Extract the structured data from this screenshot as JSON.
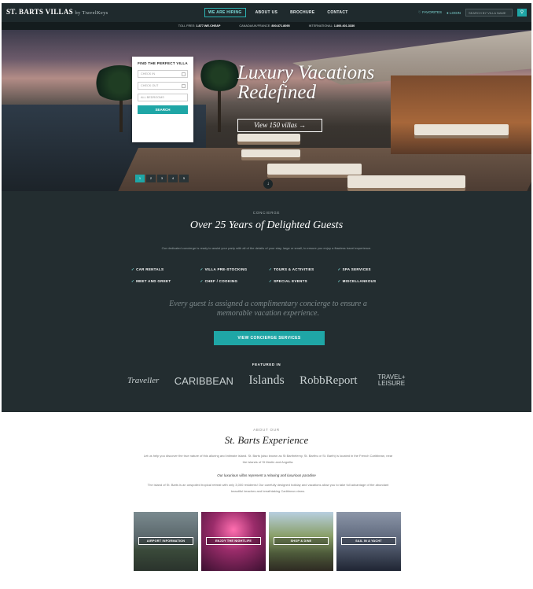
{
  "header": {
    "logo": "ST. BARTS VILLAS",
    "logo_sub": "by TravelKeys",
    "nav": [
      "WE ARE HIRING",
      "ABOUT US",
      "BROCHURE",
      "CONTACT"
    ],
    "links": [
      "FAVORITES",
      "LOGIN"
    ],
    "search_placeholder": "SEARCH BY VILLA NAME",
    "search_icon": "search-icon",
    "phones": [
      {
        "label": "TOLL FREE:",
        "value": "1.877.WE.CHEAP"
      },
      {
        "label": "CANADA/UK/FRANCE:",
        "value": "800.871.8095"
      },
      {
        "label": "INTERNATIONAL:",
        "value": "1.800.401.3330"
      }
    ]
  },
  "hero": {
    "title": "Luxury Vacations Redefined",
    "cta": "View 150 villas →",
    "finder": {
      "title": "FIND THE PERFECT VILLA",
      "fields": [
        "CHECK IN",
        "CHECK OUT",
        "ALL BEDROOMS"
      ],
      "button": "SEARCH"
    },
    "slides": [
      "1",
      "2",
      "3",
      "4",
      "5"
    ],
    "scroll_icon": "arrow-down-icon"
  },
  "concierge": {
    "eyebrow": "CONCIERGE",
    "title": "Over 25 Years of Delighted Guests",
    "description": "Our dedicated concierge is ready to assist your party with all of the details of your stay, large or small, to ensure you enjoy a flawless travel experience.",
    "services": [
      "CAR RENTALS",
      "VILLA PRE-STOCKING",
      "TOURS & ACTIVITIES",
      "SPA SERVICES",
      "MEET AND GREET",
      "CHEF / COOKING",
      "SPECIAL EVENTS",
      "MISCELLANEOUS"
    ],
    "quote": "Every guest is assigned a complimentary concierge to ensure a memorable vacation experience.",
    "button": "VIEW CONCIERGE SERVICES",
    "featured_label": "FEATURED IN",
    "publications": [
      "Traveller",
      "CARIBBEAN",
      "Islands",
      "RobbReport",
      "TRAVEL+ LEISURE"
    ]
  },
  "about": {
    "eyebrow": "ABOUT OUR",
    "title": "St. Barts Experience",
    "description": "Let us help you discover the true nature of this alluring and intimate island. St. Barts (also known as St Barthelemy, St. Barths or St. Barth) is located in the French Caribbean, near the islands of St Martin and Anguilla.",
    "subheading": "Our luxurious villas represent a relaxing and luxurious paradise",
    "description2": "The island of St. Barts is an unspoiled tropical retreat with only 3,000 residents! Our carefully designed holiday and vacations allow you to take full advantage of the abundant beautiful beaches and breathtaking Caribbean views.",
    "tiles": [
      "AIRPORT INFORMATION",
      "ENJOY THE NIGHTLIFE",
      "SHOP & DINE",
      "SAIL IN A YACHT"
    ]
  },
  "colors": {
    "accent": "#1fa6a6",
    "dark_bg": "#232d30",
    "nav_bg": "#1f2a2d"
  }
}
